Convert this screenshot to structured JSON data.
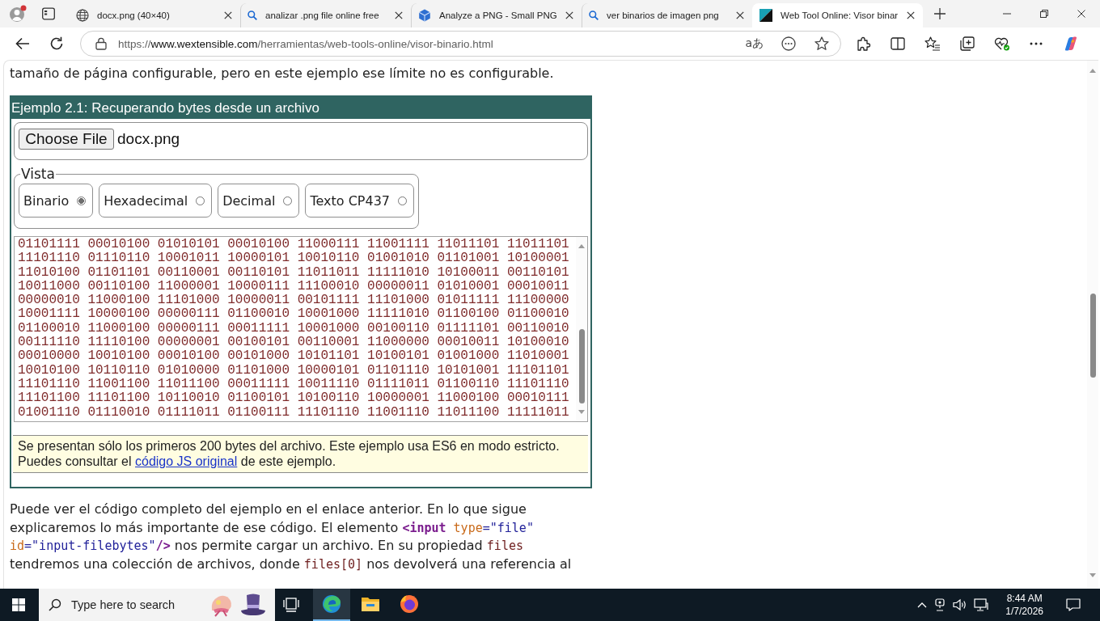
{
  "browser": {
    "tabs": [
      {
        "kind": "web",
        "title": "docx.png (40×40)",
        "selected": false
      },
      {
        "kind": "search",
        "title": "analizar .png file online free",
        "selected": false
      },
      {
        "kind": "app",
        "title": "Analyze a PNG - Small PNG",
        "selected": false
      },
      {
        "kind": "search",
        "title": "ver binarios de imagen png",
        "selected": false
      },
      {
        "kind": "site",
        "title": "Web Tool Online: Visor binar",
        "selected": true
      }
    ],
    "address": {
      "scheme": "https://",
      "host": "www.wextensible.com",
      "path": "/herramientas/web-tools-online/visor-binario.html",
      "glyph": "aあ"
    }
  },
  "page": {
    "intro": "tamaño de página configurable, pero en este ejemplo ese límite no es configurable.",
    "example": {
      "title": "Ejemplo 2.1: Recuperando bytes desde un archivo",
      "file_button": "Choose File",
      "file_name": "docx.png",
      "view": {
        "legend": "Vista",
        "options": [
          {
            "label": "Binario",
            "selected": true
          },
          {
            "label": "Hexadecimal",
            "selected": false
          },
          {
            "label": "Decimal",
            "selected": false
          },
          {
            "label": "Texto CP437",
            "selected": false
          }
        ]
      },
      "output_rows": [
        "01101111 00010100 01010101 00010100 11000111 11001111 11011101 11011101",
        "11101110 01110110 10001011 10000101 10010110 01001010 01101001 10100001",
        "11010100 01101101 00110001 00110101 11011011 11111010 10100011 00110101",
        "10011000 00110100 11000001 10000111 11100010 00000011 01010001 00010011",
        "00000010 11000100 11101000 10000011 00101111 11101000 01011111 11100000",
        "10001111 10000100 00000111 01100010 10001000 11111010 01100100 01100010",
        "01100010 11000100 00000111 00011111 10001000 00100110 01111101 00110010",
        "00111110 11110100 00000001 00100101 00110001 11000000 00010011 10100010",
        "00010000 10010100 00010100 00101000 10101101 10100101 01001000 11010001",
        "10010100 10110110 01010000 01101000 10000101 01101110 10101001 11101101",
        "11101110 11001100 11011100 00011111 10011110 01111011 01100110 11101110",
        "11101100 11101100 10110010 01100101 10100110 10000001 11000100 00010111",
        "01001110 01110010 01111011 01100111 11101110 11001110 11011100 11111011"
      ],
      "note": [
        {
          "kind": "text",
          "text": "Se presentan sólo los primeros 200 bytes del archivo. Este ejemplo usa ES6 en modo estricto. Puedes consultar el "
        },
        {
          "kind": "link",
          "text": "código JS original"
        },
        {
          "kind": "text",
          "text": " de este ejemplo."
        }
      ]
    },
    "paragraph": [
      {
        "kind": "text",
        "text": "Puede ver el código completo del ejemplo en el enlace anterior. En lo que sigue explicaremos lo más importante de ese código. El elemento "
      },
      {
        "kind": "tag",
        "text": "<input"
      },
      {
        "kind": "attr",
        "text": " type"
      },
      {
        "kind": "value",
        "text": "=\"file\""
      },
      {
        "kind": "attr",
        "text": " id"
      },
      {
        "kind": "value",
        "text": "=\"input-filebytes\""
      },
      {
        "kind": "tag",
        "text": "/>"
      },
      {
        "kind": "text",
        "text": " nos permite cargar un archivo. En su propiedad "
      },
      {
        "kind": "code",
        "text": "files"
      },
      {
        "kind": "text",
        "text": " tendremos una colección de archivos, donde "
      },
      {
        "kind": "code",
        "text": "files[0]"
      },
      {
        "kind": "text",
        "text": " nos devolverá una referencia al"
      }
    ]
  },
  "taskbar": {
    "search": {
      "placeholder": "Type here to search"
    },
    "apps": [
      {
        "kind": "swirl",
        "selected": true
      },
      {
        "kind": "folder",
        "selected": false
      },
      {
        "kind": "fox",
        "selected": false
      }
    ],
    "time": "8:44 AM",
    "date": "1/7/2026"
  }
}
